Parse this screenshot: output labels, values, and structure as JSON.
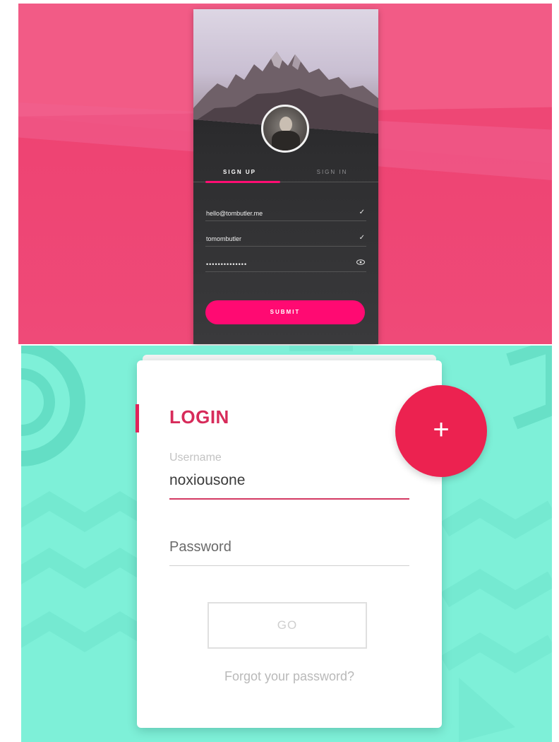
{
  "signup_screen": {
    "tabs": [
      {
        "label": "SIGN UP",
        "active": true
      },
      {
        "label": "SIGN IN",
        "active": false
      }
    ],
    "fields": [
      {
        "value": "hello@tombutler.me",
        "icon": "check-icon"
      },
      {
        "value": "tomombutler",
        "icon": "check-icon"
      },
      {
        "value": "••••••••••••••",
        "icon": "eye-icon"
      }
    ],
    "submit_label": "SUBMIT",
    "colors": {
      "background": "#ee4775",
      "accent": "#ff0a72"
    }
  },
  "login_card": {
    "title": "LOGIN",
    "fab_label": "+",
    "username_label": "Username",
    "username_value": "noxiousone",
    "password_label": "Password",
    "go_label": "GO",
    "forgot_link": "Forgot your password?",
    "colors": {
      "background": "#7ef0d8",
      "accent": "#e0245a"
    }
  }
}
